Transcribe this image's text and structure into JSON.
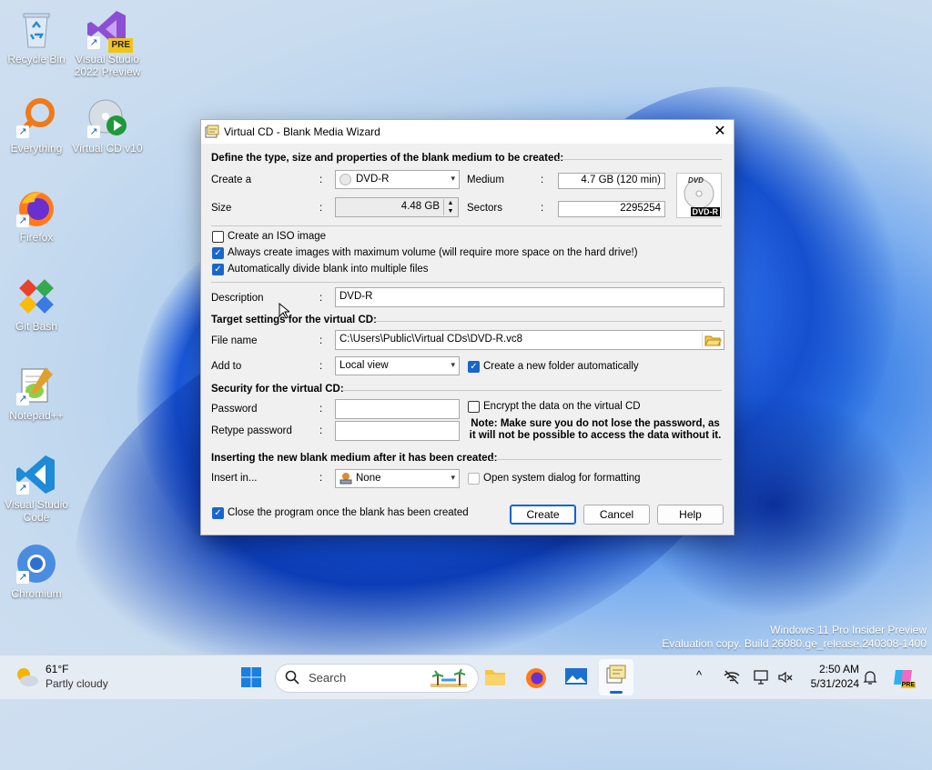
{
  "desktop": {
    "icons": [
      {
        "label": "Recycle Bin"
      },
      {
        "label": "Visual Studio 2022 Preview"
      },
      {
        "label": "Everything"
      },
      {
        "label": "Virtual CD v10"
      },
      {
        "label": "Firefox"
      },
      {
        "label": "Git Bash"
      },
      {
        "label": "Notepad++"
      },
      {
        "label": "Visual Studio Code"
      },
      {
        "label": "Chromium"
      }
    ],
    "vs_badge": "PRE",
    "watermark_line1": "Windows 11 Pro Insider Preview",
    "watermark_line2": "Evaluation copy. Build 26080.ge_release.240308-1400"
  },
  "dialog": {
    "title": "Virtual CD - Blank Media Wizard",
    "close_glyph": "✕",
    "section_define": "Define the type, size and properties of the blank medium to be created:",
    "create_a_label": "Create a",
    "create_a_value": "DVD-R",
    "medium_label": "Medium",
    "medium_value": "4.7 GB (120 min)",
    "size_label": "Size",
    "size_value": "4.48 GB",
    "sectors_label": "Sectors",
    "sectors_value": "2295254",
    "disc_badge": "DVD-R",
    "disc_logo": "DVD",
    "colon": ":",
    "chk_iso": "Create an ISO image",
    "chk_iso_checked": false,
    "chk_maxvol": "Always create images with maximum volume (will require more space on the hard drive!)",
    "chk_maxvol_checked": true,
    "chk_divide": "Automatically divide blank into multiple files",
    "chk_divide_checked": true,
    "description_label": "Description",
    "description_value": "DVD-R",
    "section_target": "Target settings for the virtual CD:",
    "filename_label": "File name",
    "filename_value": "C:\\Users\\Public\\Virtual CDs\\DVD-R.vc8",
    "addto_label": "Add to",
    "addto_value": "Local view",
    "chk_newfolder": "Create a new folder automatically",
    "chk_newfolder_checked": true,
    "section_security": "Security for the virtual CD:",
    "password_label": "Password",
    "password_value": "",
    "retype_label": "Retype password",
    "retype_value": "",
    "chk_encrypt": "Encrypt the data on the virtual CD",
    "chk_encrypt_checked": false,
    "note": "Note: Make sure you do not lose the password, as it will not be possible to access the data without it.",
    "section_insert": "Inserting the new blank medium after it has been created:",
    "insertin_label": "Insert in...",
    "insertin_value": "None",
    "chk_opensys": "Open system dialog for formatting",
    "chk_opensys_checked": false,
    "chk_close": "Close the program once the blank has been created",
    "chk_close_checked": true,
    "btn_create": "Create",
    "btn_cancel": "Cancel",
    "btn_help": "Help"
  },
  "taskbar": {
    "weather_temp": "61°F",
    "weather_desc": "Partly cloudy",
    "search_placeholder": "Search",
    "time": "2:50 AM",
    "date": "5/31/2024",
    "tray_chevron": "^"
  }
}
